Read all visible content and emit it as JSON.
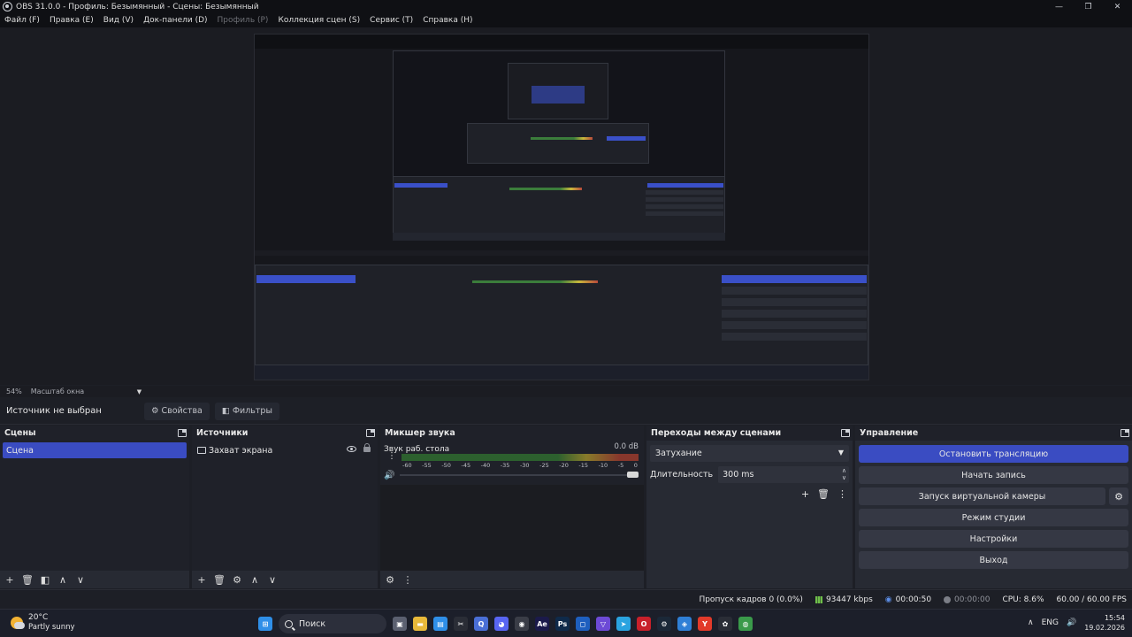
{
  "window": {
    "title": "OBS 31.0.0 - Профиль: Безымянный - Сцены: Безымянный",
    "controls": [
      "—",
      "❐",
      "✕"
    ]
  },
  "menu": [
    {
      "label": "Файл (F)",
      "enabled": true
    },
    {
      "label": "Правка (E)",
      "enabled": true
    },
    {
      "label": "Вид (V)",
      "enabled": true
    },
    {
      "label": "Док-панели (D)",
      "enabled": true
    },
    {
      "label": "Профиль (P)",
      "enabled": false
    },
    {
      "label": "Коллекция сцен (S)",
      "enabled": true
    },
    {
      "label": "Сервис (T)",
      "enabled": true
    },
    {
      "label": "Справка (H)",
      "enabled": true
    }
  ],
  "preview": {
    "zoom": "54%",
    "zoom_label": "Масштаб окна"
  },
  "sourcebar": {
    "no_source": "Источник не выбран",
    "properties": "Свойства",
    "filters": "Фильтры"
  },
  "scenes": {
    "title": "Сцены",
    "items": [
      {
        "label": "Сцена",
        "selected": true
      }
    ]
  },
  "sources": {
    "title": "Источники",
    "items": [
      {
        "label": "Захват экрана",
        "icon": "monitor-icon"
      }
    ]
  },
  "mixer": {
    "title": "Микшер звука",
    "channel": "Звук раб. стола",
    "db": "0.0 dB",
    "ticks": [
      "-60",
      "-55",
      "-50",
      "-45",
      "-40",
      "-35",
      "-30",
      "-25",
      "-20",
      "-15",
      "-10",
      "-5",
      "0"
    ],
    "volume": 1.0
  },
  "transitions": {
    "title": "Переходы между сценами",
    "selected": "Затухание",
    "duration_label": "Длительность",
    "duration_value": "300 ms"
  },
  "controls": {
    "title": "Управление",
    "stop_stream": "Остановить трансляцию",
    "start_record": "Начать запись",
    "virtual_cam": "Запуск виртуальной камеры",
    "studio_mode": "Режим студии",
    "settings": "Настройки",
    "exit": "Выход"
  },
  "status": {
    "dropped": "Пропуск кадров 0 (0.0%)",
    "bitrate": "93447 kbps",
    "stream_time": "00:00:50",
    "rec_time": "00:00:00",
    "cpu": "CPU: 8.6%",
    "fps": "60.00 / 60.00 FPS"
  },
  "taskbar": {
    "temperature": "20°C",
    "weather": "Partly sunny",
    "search": "Поиск",
    "lang": "ENG",
    "time": "15:54",
    "date": "19.02.2026",
    "apps": [
      {
        "name": "windows-start-icon",
        "glyph": "⊞",
        "color": "#2f8fe8"
      },
      {
        "name": "task-view-icon",
        "glyph": "▣",
        "color": "#5b6070"
      },
      {
        "name": "file-explorer-icon",
        "glyph": "▬",
        "color": "#e8b93a"
      },
      {
        "name": "store-icon",
        "glyph": "▤",
        "color": "#2f8fe8"
      },
      {
        "name": "capcut-icon",
        "glyph": "✂",
        "color": "#2a2d36"
      },
      {
        "name": "app-q-icon",
        "glyph": "Q",
        "color": "#4a6fd6"
      },
      {
        "name": "discord-icon",
        "glyph": "◕",
        "color": "#5865f2"
      },
      {
        "name": "obs-icon",
        "glyph": "◉",
        "color": "#3a3d47"
      },
      {
        "name": "after-effects-icon",
        "glyph": "Ae",
        "color": "#1b1a4a"
      },
      {
        "name": "photoshop-icon",
        "glyph": "Ps",
        "color": "#0f2a4a"
      },
      {
        "name": "app-square-icon",
        "glyph": "◻",
        "color": "#1e5fbf"
      },
      {
        "name": "proton-vpn-icon",
        "glyph": "▽",
        "color": "#6d4ad6"
      },
      {
        "name": "telegram-icon",
        "glyph": "➤",
        "color": "#2aa3e0"
      },
      {
        "name": "opera-icon",
        "glyph": "O",
        "color": "#c8202a"
      },
      {
        "name": "steam-icon",
        "glyph": "⚙",
        "color": "#1b2838"
      },
      {
        "name": "security-icon",
        "glyph": "◈",
        "color": "#2f7fd6"
      },
      {
        "name": "yandex-icon",
        "glyph": "Y",
        "color": "#e23a2a"
      },
      {
        "name": "colorful-app-icon",
        "glyph": "✿",
        "color": "#2a2d36"
      },
      {
        "name": "chrome-icon",
        "glyph": "◍",
        "color": "#3a9a4a"
      }
    ]
  }
}
